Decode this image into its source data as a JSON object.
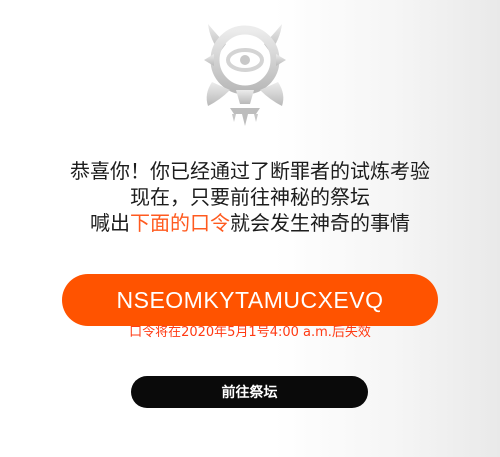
{
  "emblem": {
    "icon": "altar-seal-icon",
    "color": "#cfcfcf"
  },
  "message": {
    "line1": "恭喜你！你已经通过了断罪者的试炼考验",
    "line2": "现在，只要前往神秘的祭坛",
    "line3_prefix": "喊出",
    "line3_highlight": "下面的口令",
    "line3_suffix": "就会发生神奇的事情",
    "highlight_color": "#ff5a1f"
  },
  "code": {
    "value": "NSEOMKYTAMUCXEVQ",
    "background": "#ff5300"
  },
  "expiry": {
    "text": "口令将在2020年5月1号4:00 a.m.后失效",
    "color": "#ff3b14"
  },
  "action": {
    "label": "前往祭坛",
    "background": "#0a0a0a"
  }
}
